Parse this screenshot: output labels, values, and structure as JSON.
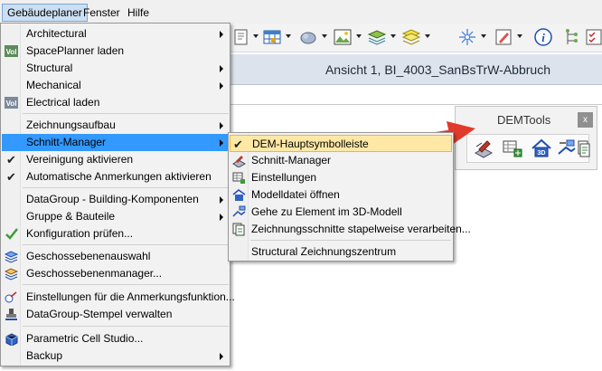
{
  "menubar": {
    "items": [
      {
        "label": "Gebäudeplaner"
      },
      {
        "label": "Fenster"
      },
      {
        "label": "Hilfe"
      }
    ]
  },
  "view": {
    "title": "Ansicht 1, BI_4003_SanBsTrW-Abbruch"
  },
  "demtools": {
    "title": "DEMTools",
    "close": "x"
  },
  "main_menu": {
    "items": [
      {
        "label": "Architectural"
      },
      {
        "label": "SpacePlanner laden"
      },
      {
        "label": "Structural"
      },
      {
        "label": "Mechanical"
      },
      {
        "label": "Electrical laden"
      },
      {
        "label": "Zeichnungsaufbau"
      },
      {
        "label": "Schnitt-Manager"
      },
      {
        "label": "Vereinigung aktivieren"
      },
      {
        "label": "Automatische Anmerkungen aktivieren"
      },
      {
        "label": "DataGroup - Building-Komponenten"
      },
      {
        "label": "Gruppe & Bauteile"
      },
      {
        "label": "Konfiguration prüfen..."
      },
      {
        "label": "Geschossebenenauswahl"
      },
      {
        "label": "Geschossebenenmanager..."
      },
      {
        "label": "Einstellungen für die Anmerkungsfunktion..."
      },
      {
        "label": "DataGroup-Stempel verwalten"
      },
      {
        "label": "Parametric Cell Studio..."
      },
      {
        "label": "Backup"
      }
    ]
  },
  "sub_menu": {
    "items": [
      {
        "label": "DEM-Hauptsymbolleiste"
      },
      {
        "label": "Schnitt-Manager"
      },
      {
        "label": "Einstellungen"
      },
      {
        "label": "Modelldatei öffnen"
      },
      {
        "label": "Gehe zu Element im 3D-Modell"
      },
      {
        "label": "Zeichnungsschnitte stapelweise verarbeiten..."
      },
      {
        "label": "Structural Zeichnungszentrum"
      }
    ]
  },
  "colors": {
    "highlight": "#3399ff",
    "sub_highlight": "#ffe8a6",
    "arrow": "#e03a2a"
  }
}
